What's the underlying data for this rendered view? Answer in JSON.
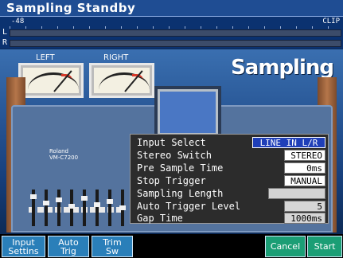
{
  "title": "Sampling Standby",
  "meter": {
    "scale_min": "-48",
    "clip": "CLIP",
    "left_channel": "L",
    "right_channel": "R"
  },
  "vu": {
    "left_label": "LEFT",
    "right_label": "RIGHT"
  },
  "background": {
    "brand_line1": "Roland",
    "brand_line2": "VM-C7200",
    "heading": "Sampling"
  },
  "settings": {
    "rows": [
      {
        "label": "Input Select",
        "value": "LINE IN L/R"
      },
      {
        "label": "Stereo Switch",
        "value": "STEREO"
      },
      {
        "label": "Pre Sample Time",
        "value": "0ms"
      },
      {
        "label": "Stop Trigger",
        "value": "MANUAL"
      },
      {
        "label": "Sampling Length",
        "value": ""
      },
      {
        "label": "Auto Trigger Level",
        "value": "5"
      },
      {
        "label": "Gap Time",
        "value": "1000ms"
      }
    ]
  },
  "buttons": {
    "input_settings": "Input Settins",
    "auto_trig": "Auto Trig",
    "trim_sw": "Trim Sw",
    "cancel": "Cancel",
    "start": "Start"
  },
  "colors": {
    "title_bar": "#1f4d93",
    "selected_value": "#1f3fb8",
    "function_button": "#2a7fb9",
    "action_button": "#1b9e75"
  }
}
